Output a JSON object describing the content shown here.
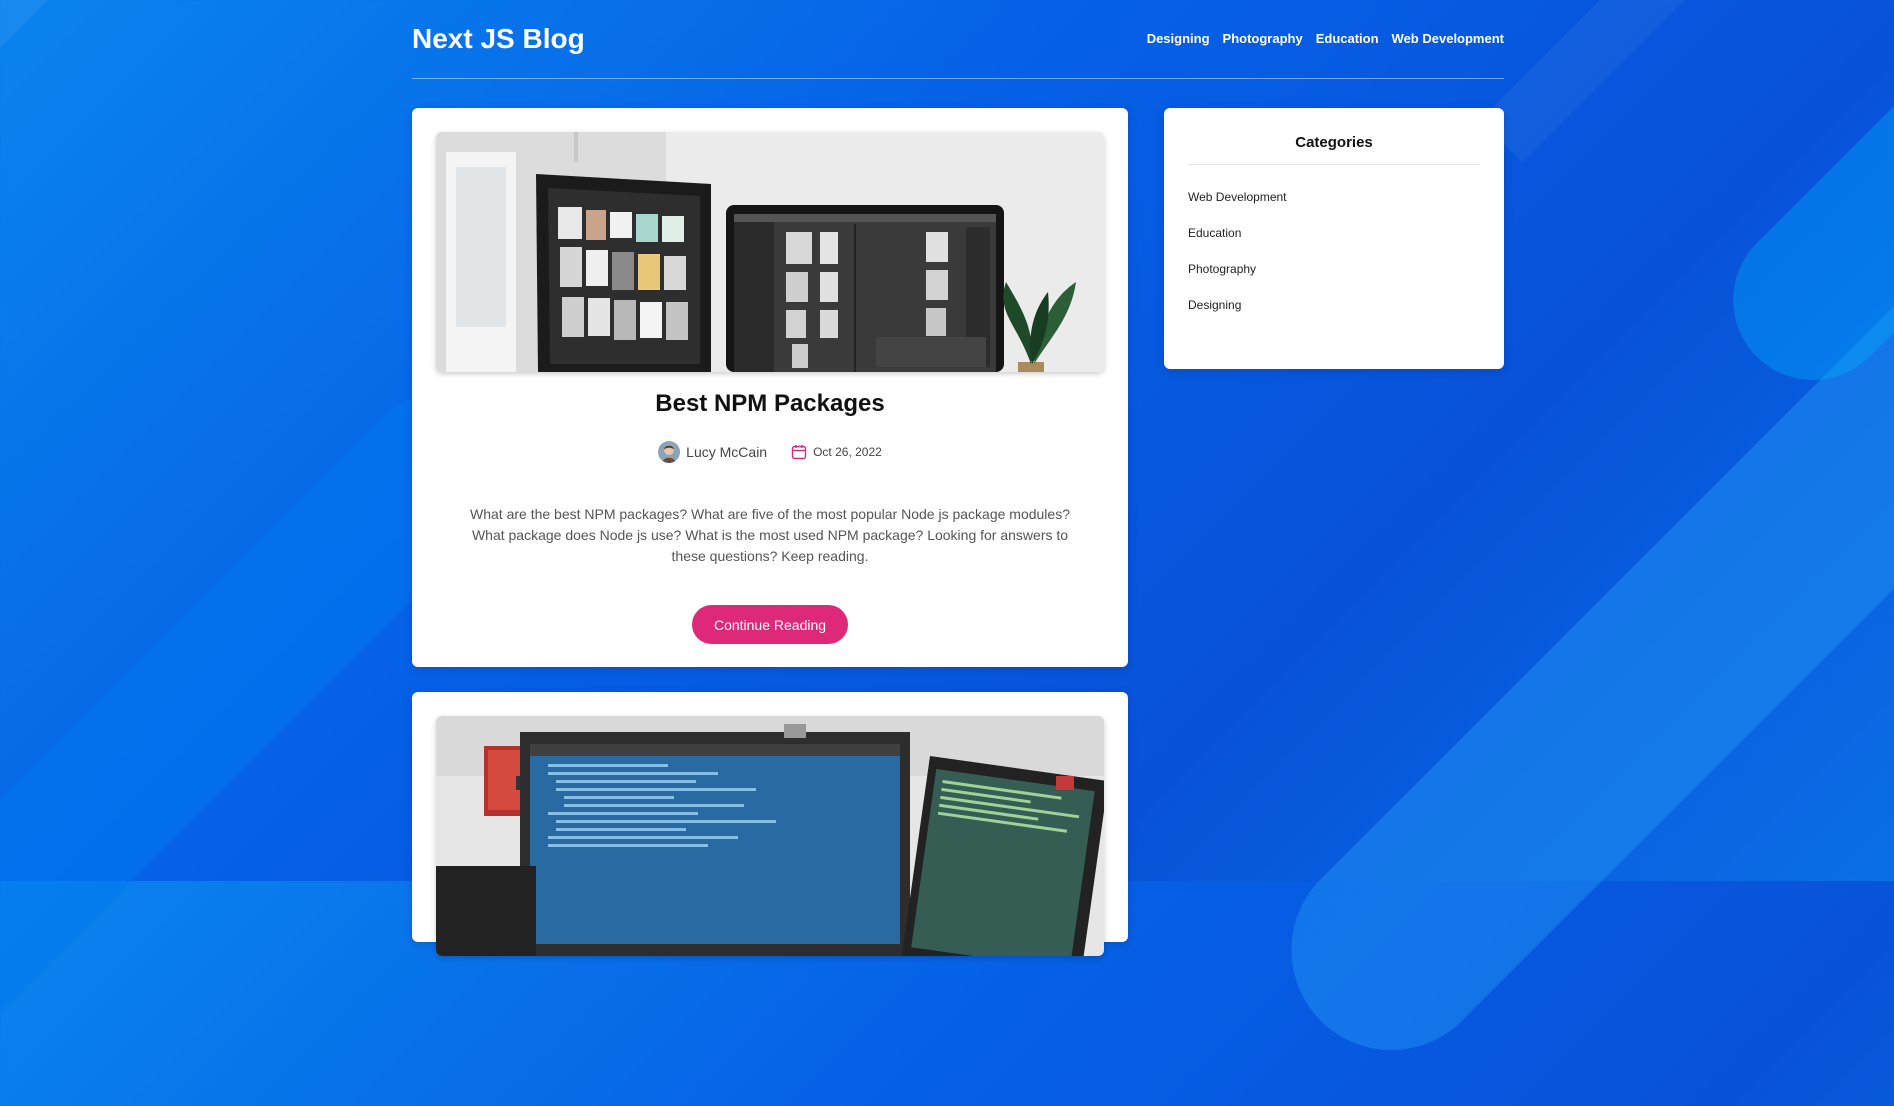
{
  "site": {
    "title": "Next JS Blog"
  },
  "nav": {
    "items": [
      {
        "label": "Designing"
      },
      {
        "label": "Photography"
      },
      {
        "label": "Education"
      },
      {
        "label": "Web Development"
      }
    ]
  },
  "posts": [
    {
      "title": "Best NPM Packages",
      "author": "Lucy McCain",
      "date": "Oct 26, 2022",
      "excerpt": "What are the best NPM packages? What are five of the most popular Node js package modules? What package does Node js use? What is the most used NPM package? Looking for answers to these questions? Keep reading.",
      "button_label": "Continue Reading"
    }
  ],
  "sidebar": {
    "title": "Categories",
    "categories": [
      {
        "label": "Web Development"
      },
      {
        "label": "Education"
      },
      {
        "label": "Photography"
      },
      {
        "label": "Designing"
      }
    ]
  },
  "colors": {
    "accent": "#de2878",
    "background": "#0660e6"
  }
}
